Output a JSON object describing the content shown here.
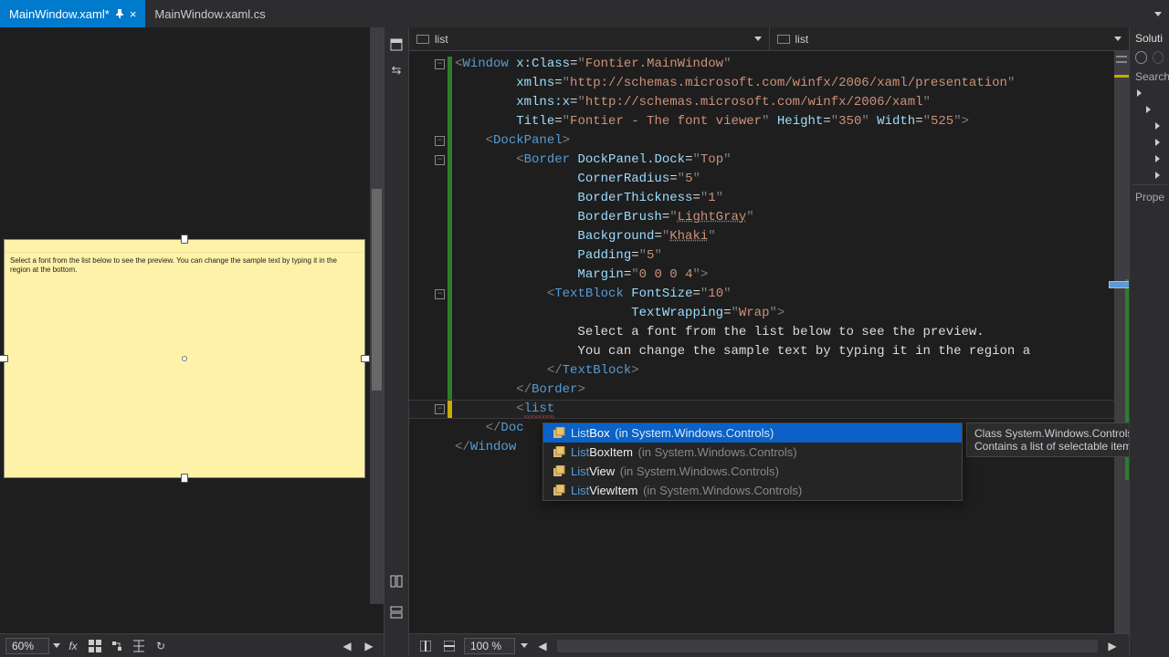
{
  "tabs": [
    {
      "label": "MainWindow.xaml*",
      "active": true,
      "pinned": true
    },
    {
      "label": "MainWindow.xaml.cs",
      "active": false,
      "pinned": false
    }
  ],
  "designer": {
    "zoom": "60%",
    "sample_text": "Select a font from the list below to see the preview. You can change the sample text by typing it in the region at the bottom."
  },
  "breadcrumb": {
    "left": "list",
    "right": "list"
  },
  "code_zoom": "100 %",
  "code_lines": [
    {
      "indent": 0,
      "raw": "<Window x:Class=\"Fontier.MainWindow\"",
      "fold": true
    },
    {
      "indent": 0,
      "raw": "        xmlns=\"http://schemas.microsoft.com/winfx/2006/xaml/presentation\""
    },
    {
      "indent": 0,
      "raw": "        xmlns:x=\"http://schemas.microsoft.com/winfx/2006/xaml\""
    },
    {
      "indent": 0,
      "raw": "        Title=\"Fontier - The font viewer\" Height=\"350\" Width=\"525\">"
    },
    {
      "indent": 1,
      "raw": "<DockPanel>",
      "fold": true
    },
    {
      "indent": 2,
      "raw": "<Border DockPanel.Dock=\"Top\"",
      "fold": true
    },
    {
      "indent": 2,
      "raw": "        CornerRadius=\"5\""
    },
    {
      "indent": 2,
      "raw": "        BorderThickness=\"1\""
    },
    {
      "indent": 2,
      "raw": "        BorderBrush=\"LightGray\"",
      "ul": "LightGray"
    },
    {
      "indent": 2,
      "raw": "        Background=\"Khaki\"",
      "ul": "Khaki"
    },
    {
      "indent": 2,
      "raw": "        Padding=\"5\""
    },
    {
      "indent": 2,
      "raw": "        Margin=\"0 0 0 4\">"
    },
    {
      "indent": 3,
      "raw": "<TextBlock FontSize=\"10\"",
      "fold": true
    },
    {
      "indent": 3,
      "raw": "           TextWrapping=\"Wrap\">"
    },
    {
      "indent": 3,
      "text": "    Select a font from the list below to see the preview."
    },
    {
      "indent": 3,
      "text": "    You can change the sample text by typing it in the region a"
    },
    {
      "indent": 3,
      "raw": "</TextBlock>"
    },
    {
      "indent": 2,
      "raw": "</Border>"
    },
    {
      "indent": 2,
      "raw": "<list",
      "squiggle": true,
      "current": true,
      "fold": true,
      "yellow": true
    },
    {
      "indent": 1,
      "raw": "</Doc",
      "cut": true
    },
    {
      "indent": 0,
      "raw": "</Window",
      "cut": true
    }
  ],
  "intellisense": {
    "items": [
      {
        "match": "List",
        "rest": "Box",
        "ns": "(in System.Windows.Controls)",
        "selected": true
      },
      {
        "match": "List",
        "rest": "BoxItem",
        "ns": "(in System.Windows.Controls)"
      },
      {
        "match": "List",
        "rest": "View",
        "ns": "(in System.Windows.Controls)"
      },
      {
        "match": "List",
        "rest": "ViewItem",
        "ns": "(in System.Windows.Controls)"
      }
    ],
    "tooltip_line1": "Class System.Windows.Controls.L",
    "tooltip_line2": "Contains a list of selectable item"
  },
  "right": {
    "title": "Soluti",
    "search": "Search",
    "properties": "Prope"
  }
}
